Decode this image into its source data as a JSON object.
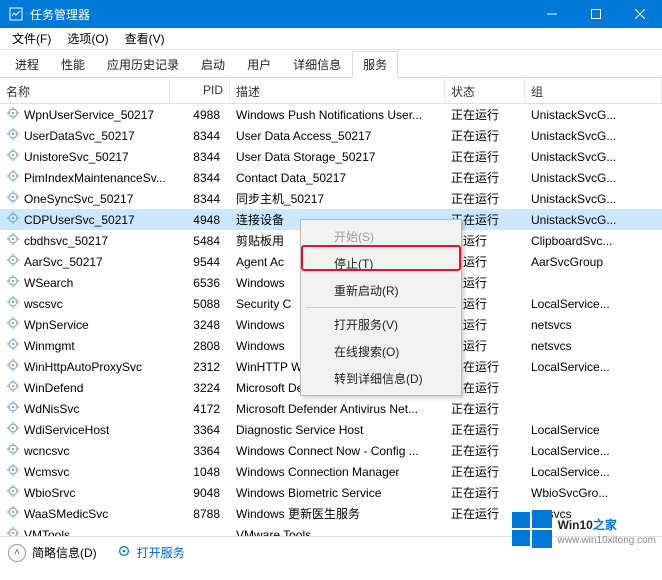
{
  "window": {
    "title": "任务管理器"
  },
  "menu": {
    "file": "文件(F)",
    "options": "选项(O)",
    "view": "查看(V)"
  },
  "tabs": [
    "进程",
    "性能",
    "应用历史记录",
    "启动",
    "用户",
    "详细信息",
    "服务"
  ],
  "activeTab": 6,
  "columns": {
    "name": "名称",
    "pid": "PID",
    "desc": "描述",
    "status": "状态",
    "group": "组"
  },
  "rows": [
    {
      "name": "WpnUserService_50217",
      "pid": "4988",
      "desc": "Windows Push Notifications User...",
      "status": "正在运行",
      "group": "UnistackSvcG..."
    },
    {
      "name": "UserDataSvc_50217",
      "pid": "8344",
      "desc": "User Data Access_50217",
      "status": "正在运行",
      "group": "UnistackSvcG..."
    },
    {
      "name": "UnistoreSvc_50217",
      "pid": "8344",
      "desc": "User Data Storage_50217",
      "status": "正在运行",
      "group": "UnistackSvcG..."
    },
    {
      "name": "PimIndexMaintenanceSv...",
      "pid": "8344",
      "desc": "Contact Data_50217",
      "status": "正在运行",
      "group": "UnistackSvcG..."
    },
    {
      "name": "OneSyncSvc_50217",
      "pid": "8344",
      "desc": "同步主机_50217",
      "status": "正在运行",
      "group": "UnistackSvcG..."
    },
    {
      "name": "CDPUserSvc_50217",
      "pid": "4948",
      "desc": "连接设备",
      "status": "正在运行",
      "group": "UnistackSvcG...",
      "sel": true
    },
    {
      "name": "cbdhsvc_50217",
      "pid": "5484",
      "desc": "剪贴板用",
      "status": "在运行",
      "group": "ClipboardSvc..."
    },
    {
      "name": "AarSvc_50217",
      "pid": "9544",
      "desc": "Agent Ac",
      "status": "在运行",
      "group": "AarSvcGroup"
    },
    {
      "name": "WSearch",
      "pid": "6536",
      "desc": "Windows",
      "status": "在运行",
      "group": ""
    },
    {
      "name": "wscsvc",
      "pid": "5088",
      "desc": "Security C",
      "status": "在运行",
      "group": "LocalService..."
    },
    {
      "name": "WpnService",
      "pid": "3248",
      "desc": "Windows",
      "status": "在运行",
      "group": "netsvcs"
    },
    {
      "name": "Winmgmt",
      "pid": "2808",
      "desc": "Windows",
      "status": "在运行",
      "group": "netsvcs"
    },
    {
      "name": "WinHttpAutoProxySvc",
      "pid": "2312",
      "desc": "WinHTTP Web Proxy Auto-Discov...",
      "status": "正在运行",
      "group": "LocalService..."
    },
    {
      "name": "WinDefend",
      "pid": "3224",
      "desc": "Microsoft Defender Antivirus Ser...",
      "status": "正在运行",
      "group": ""
    },
    {
      "name": "WdNisSvc",
      "pid": "4172",
      "desc": "Microsoft Defender Antivirus Net...",
      "status": "正在运行",
      "group": ""
    },
    {
      "name": "WdiServiceHost",
      "pid": "3364",
      "desc": "Diagnostic Service Host",
      "status": "正在运行",
      "group": "LocalService"
    },
    {
      "name": "wcncsvc",
      "pid": "3364",
      "desc": "Windows Connect Now - Config ...",
      "status": "正在运行",
      "group": "LocalService..."
    },
    {
      "name": "Wcmsvc",
      "pid": "1048",
      "desc": "Windows Connection Manager",
      "status": "正在运行",
      "group": "LocalService..."
    },
    {
      "name": "WbioSrvc",
      "pid": "9048",
      "desc": "Windows Biometric Service",
      "status": "正在运行",
      "group": "WbioSvcGro..."
    },
    {
      "name": "WaaSMedicSvc",
      "pid": "8788",
      "desc": "Windows 更新医生服务",
      "status": "正在运行",
      "group": "netsvcs"
    },
    {
      "name": "VMTools",
      "pid": "",
      "desc": "VMware Tools",
      "status": "",
      "group": ""
    }
  ],
  "context": {
    "start": "开始(S)",
    "stop": "停止(T)",
    "restart": "重新启动(R)",
    "open": "打开服务(V)",
    "search": "在线搜索(O)",
    "details": "转到详细信息(D)"
  },
  "statusbar": {
    "less": "简略信息(D)",
    "open": "打开服务"
  },
  "watermark": {
    "brand": "Win10",
    "suffix": "之家",
    "url": "www.win10xitong.com"
  }
}
